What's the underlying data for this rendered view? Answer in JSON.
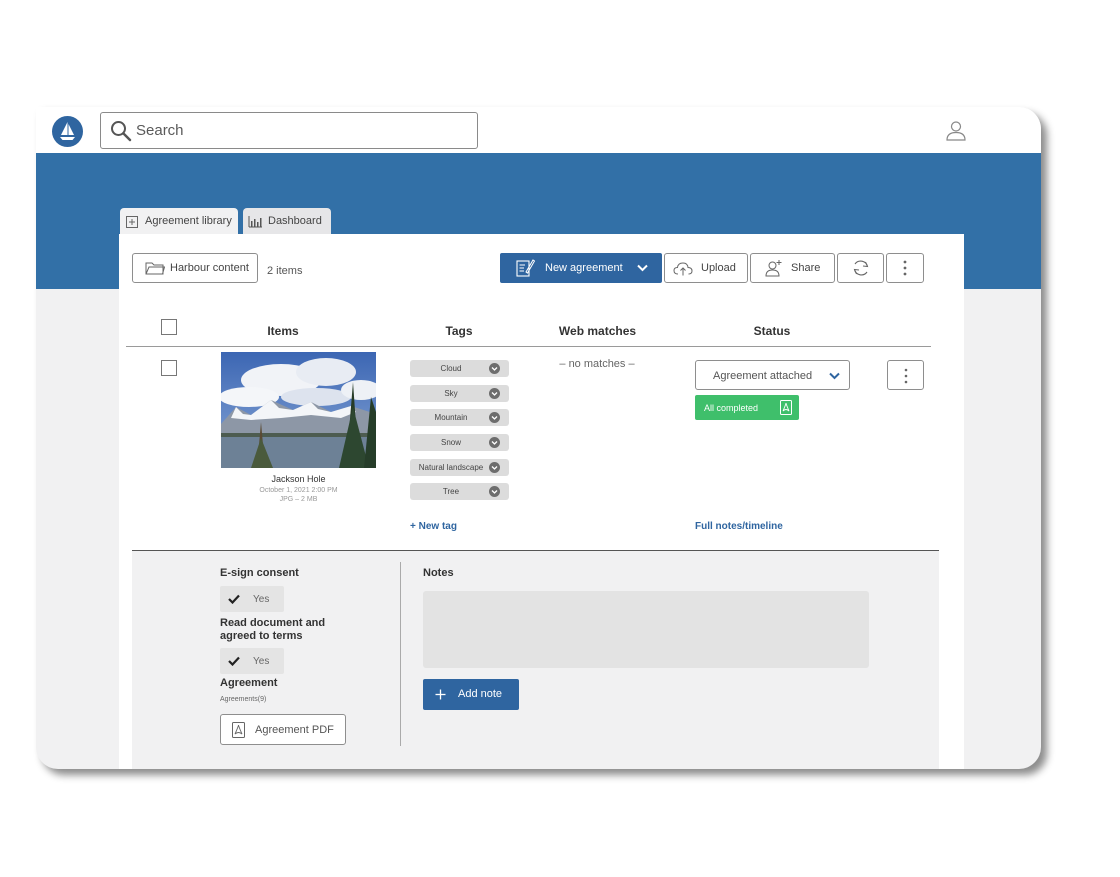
{
  "search": {
    "placeholder": "Search"
  },
  "tabs": [
    {
      "label": "Agreement library"
    },
    {
      "label": "Dashboard"
    }
  ],
  "toolbar": {
    "folder_label": "Harbour content",
    "items_count": "2 items",
    "new_agreement_label": "New agreement",
    "upload_label": "Upload",
    "share_label": "Share"
  },
  "table": {
    "headers": {
      "items": "Items",
      "tags": "Tags",
      "web_matches": "Web matches",
      "status": "Status"
    },
    "row": {
      "title": "Jackson Hole",
      "date": "October 1, 2021 2:00 PM",
      "file_info": "JPG – 2 MB",
      "tags": [
        "Cloud",
        "Sky",
        "Mountain",
        "Snow",
        "Natural landscape",
        "Tree"
      ],
      "new_tag_label": "+ New tag",
      "web_matches": "– no matches –",
      "status_value": "Agreement attached",
      "status_badge": "All completed",
      "notes_link": "Full notes/timeline"
    }
  },
  "details": {
    "esign_label": "E-sign consent",
    "esign_value": "Yes",
    "read_label": "Read document and agreed to terms",
    "read_value": "Yes",
    "agreement_label": "Agreement",
    "agreement_count": "Agreements(9)",
    "pdf_label": "Agreement PDF",
    "notes_label": "Notes",
    "add_note_label": "Add note"
  },
  "colors": {
    "brand": "#3270a7",
    "button": "#2f65a0",
    "success": "#3fbf6b"
  },
  "icons": [
    "logo-sailboat-icon",
    "search-icon",
    "user-icon",
    "library-icon",
    "dashboard-icon",
    "folder-icon",
    "agreement-icon",
    "chevron-down-icon",
    "upload-cloud-icon",
    "add-user-icon",
    "refresh-icon",
    "more-vertical-icon",
    "pdf-icon",
    "check-icon",
    "plus-icon"
  ]
}
